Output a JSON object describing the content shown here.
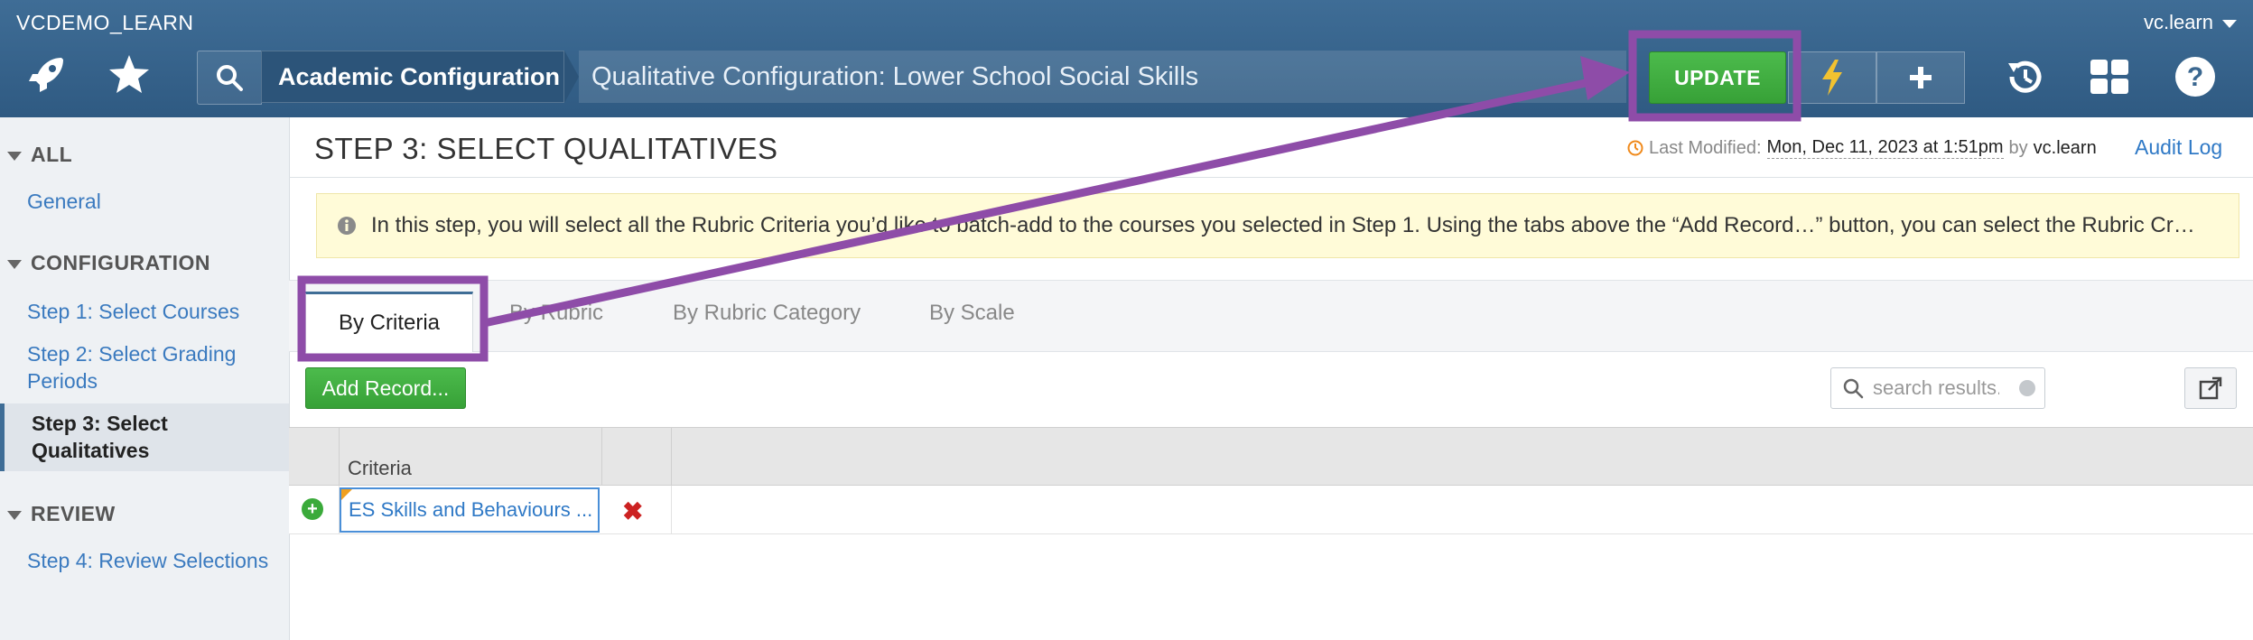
{
  "app": {
    "name": "VCDEMO_LEARN",
    "user": "vc.learn"
  },
  "header": {
    "breadcrumb_root": "Academic Configuration",
    "breadcrumb_current": "Qualitative Configuration: Lower School Social Skills",
    "update_label": "UPDATE"
  },
  "sidebar": {
    "sections": [
      {
        "label": "ALL",
        "items": [
          {
            "label": "General"
          }
        ]
      },
      {
        "label": "CONFIGURATION",
        "items": [
          {
            "label": "Step 1: Select Courses"
          },
          {
            "label": "Step 2: Select Grading Periods"
          },
          {
            "label": "Step 3: Select Qualitatives",
            "active": true
          }
        ]
      },
      {
        "label": "REVIEW",
        "items": [
          {
            "label": "Step 4: Review Selections"
          }
        ]
      }
    ]
  },
  "page": {
    "title": "STEP 3: SELECT QUALITATIVES",
    "last_modified_label": "Last Modified:",
    "last_modified_value": "Mon, Dec 11, 2023 at 1:51pm",
    "by_label": "by",
    "modified_by": "vc.learn",
    "audit_log": "Audit Log",
    "info_text": "In this step, you will select all the Rubric Criteria you’d like to batch-add to the courses you selected in Step 1. Using the tabs above the “Add Record…” button, you can select the Rubric Cr…"
  },
  "tabs": [
    {
      "label": "By Criteria",
      "active": true
    },
    {
      "label": "By Rubric"
    },
    {
      "label": "By Rubric Category"
    },
    {
      "label": "By Scale"
    }
  ],
  "toolbar": {
    "add_record_label": "Add Record...",
    "search_placeholder": "search results..."
  },
  "grid": {
    "columns": [
      "Criteria"
    ],
    "rows": [
      {
        "criteria": "ES Skills and Behaviours ..."
      }
    ]
  },
  "colors": {
    "header_bg": "#3a6790",
    "accent_green": "#3aaa3a",
    "annotation_purple": "#8e4ca8",
    "link_blue": "#2f79c6"
  }
}
